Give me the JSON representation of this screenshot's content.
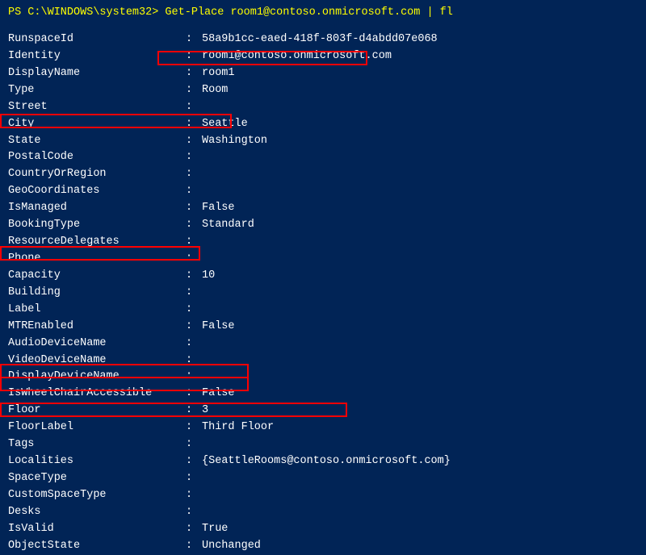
{
  "terminal": {
    "command": "PS C:\\WINDOWS\\system32> Get-Place room1@contoso.onmicrosoft.com | fl",
    "rows": [
      {
        "key": "",
        "colon": "",
        "value": ""
      },
      {
        "key": "RunspaceId",
        "colon": ":",
        "value": "58a9b1cc-eaed-418f-803f-d4abdd07e068"
      },
      {
        "key": "Identity",
        "colon": ":",
        "value": "room1@contoso.onmicrosoft.com"
      },
      {
        "key": "DisplayName",
        "colon": ":",
        "value": "room1"
      },
      {
        "key": "Type",
        "colon": ":",
        "value": "Room"
      },
      {
        "key": "Street",
        "colon": ":",
        "value": ""
      },
      {
        "key": "City",
        "colon": ":",
        "value": "Seattle"
      },
      {
        "key": "State",
        "colon": ":",
        "value": "Washington"
      },
      {
        "key": "PostalCode",
        "colon": ":",
        "value": ""
      },
      {
        "key": "CountryOrRegion",
        "colon": ":",
        "value": ""
      },
      {
        "key": "GeoCoordinates",
        "colon": ":",
        "value": ""
      },
      {
        "key": "IsManaged",
        "colon": ":",
        "value": "False"
      },
      {
        "key": "BookingType",
        "colon": ":",
        "value": "Standard"
      },
      {
        "key": "ResourceDelegates",
        "colon": ":",
        "value": ""
      },
      {
        "key": "Phone",
        "colon": ":",
        "value": ""
      },
      {
        "key": "Capacity",
        "colon": ":",
        "value": "10"
      },
      {
        "key": "Building",
        "colon": ":",
        "value": ""
      },
      {
        "key": "Label",
        "colon": ":",
        "value": ""
      },
      {
        "key": "MTREnabled",
        "colon": ":",
        "value": "False"
      },
      {
        "key": "AudioDeviceName",
        "colon": ":",
        "value": ""
      },
      {
        "key": "VideoDeviceName",
        "colon": ":",
        "value": ""
      },
      {
        "key": "DisplayDeviceName",
        "colon": ":",
        "value": ""
      },
      {
        "key": "IsWheelChairAccessible",
        "colon": ":",
        "value": "False"
      },
      {
        "key": "Floor",
        "colon": ":",
        "value": "3"
      },
      {
        "key": "FloorLabel",
        "colon": ":",
        "value": "Third Floor"
      },
      {
        "key": "Tags",
        "colon": ":",
        "value": ""
      },
      {
        "key": "Localities",
        "colon": ":",
        "value": "{SeattleRooms@contoso.onmicrosoft.com}"
      },
      {
        "key": "SpaceType",
        "colon": ":",
        "value": ""
      },
      {
        "key": "CustomSpaceType",
        "colon": ":",
        "value": ""
      },
      {
        "key": "Desks",
        "colon": ":",
        "value": ""
      },
      {
        "key": "IsValid",
        "colon": ":",
        "value": "True"
      },
      {
        "key": "ObjectState",
        "colon": ":",
        "value": "Unchanged"
      }
    ]
  }
}
